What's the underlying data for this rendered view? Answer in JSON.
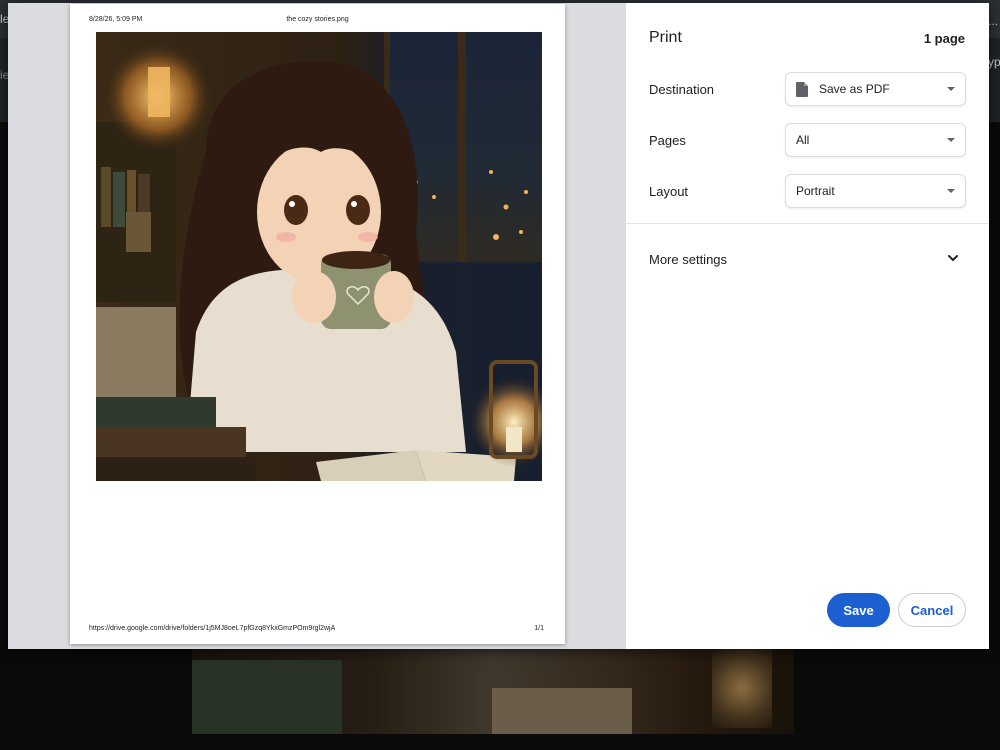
{
  "background": {
    "edge_left_top": "le",
    "edge_left_mid": "ie",
    "edge_right_top": "...",
    "edge_right_mid": "ype"
  },
  "preview": {
    "header_left": "8/28/26, 5:09 PM",
    "header_center": "the cozy stories.png",
    "footer_left": "https://drive.google.com/drive/folders/1j5MJ8oeL7pfGzq8YkxGmzPOm9rgl2wjA",
    "footer_right": "1/1"
  },
  "settings": {
    "title": "Print",
    "page_count": "1 page",
    "destination_label": "Destination",
    "destination_value": "Save as PDF",
    "destination_icon": "document-icon",
    "pages_label": "Pages",
    "pages_value": "All",
    "layout_label": "Layout",
    "layout_value": "Portrait",
    "more_settings_label": "More settings",
    "save_label": "Save",
    "cancel_label": "Cancel"
  },
  "colors": {
    "accent": "#1b5fd1",
    "preview_bg": "#dadce0",
    "overlay": "#050505"
  }
}
